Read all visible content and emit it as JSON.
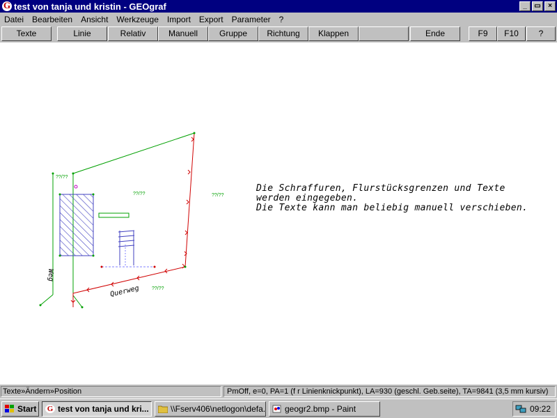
{
  "window": {
    "title": "test von tanja und kristin - GEOgraf",
    "controls": [
      "_",
      "▭",
      "×"
    ]
  },
  "menu": [
    "Datei",
    "Bearbeiten",
    "Ansicht",
    "Werkzeuge",
    "Import",
    "Export",
    "Parameter",
    "?"
  ],
  "toolbar": {
    "texte": "Texte",
    "linie": "Linie",
    "relativ": "Relativ",
    "manuell": "Manuell",
    "gruppe": "Gruppe",
    "richtung": "Richtung",
    "klappen": "Klappen",
    "blank": "",
    "ende": "Ende",
    "f9": "F9",
    "f10": "F10",
    "help": "?"
  },
  "canvas": {
    "lines": [
      "Die Schraffuren, Flurstücksgrenzen und Texte",
      "werden eingegeben.",
      "Die Texte kann man beliebig manuell verschieben."
    ],
    "labels": {
      "weg": "Weg",
      "querweg": "Querweg",
      "frac1": "??/??",
      "frac2": "??/??",
      "frac3": "??/??",
      "frac4": "??/??"
    },
    "colors": {
      "green": "#00a000",
      "red": "#d00000",
      "hatch": "#4040c0",
      "dim": "#8080ff"
    }
  },
  "status": {
    "left": "Texte»Ändern»Position",
    "right": "PmOff, e=0, PA=1 (f r Linienknickpunkt), LA=930 (geschl. Geb.seite), TA=9841 (3,5 mm kursiv)"
  },
  "taskbar": {
    "start": "Start",
    "tasks": [
      "test von tanja und kri...",
      "\\\\Fserv406\\netlogon\\defa...",
      "geogr2.bmp - Paint"
    ],
    "clock": "09:22"
  }
}
